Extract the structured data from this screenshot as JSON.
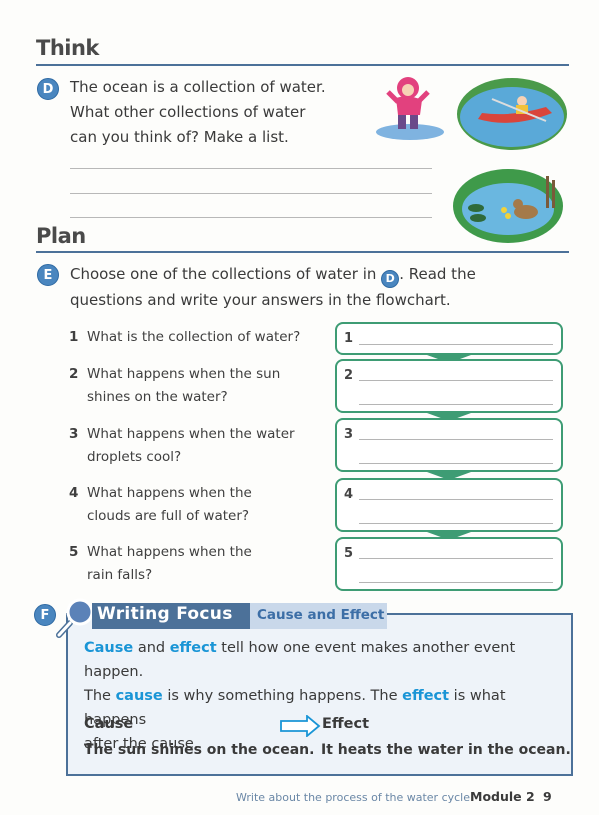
{
  "think": {
    "heading": "Think",
    "badge": "D",
    "question_lines": [
      "The ocean is a collection of water.",
      "What other collections of water",
      "can you think of? Make a list."
    ],
    "answer_lines_count": 3,
    "illustrations": [
      "girl-splashing-puddle-illustration",
      "kayak-river-illustration",
      "duck-pond-illustration"
    ]
  },
  "plan": {
    "heading": "Plan",
    "badge": "E",
    "instruction_part1": "Choose one of the collections of water in",
    "instruction_ref_badge": "D",
    "instruction_part2": ". Read the",
    "instruction_line2": "questions and write your answers in the flowchart.",
    "questions": [
      {
        "num": "1",
        "lines": [
          "What is the collection of water?"
        ]
      },
      {
        "num": "2",
        "lines": [
          "What happens when the sun",
          "shines on the water?"
        ]
      },
      {
        "num": "3",
        "lines": [
          "What happens when the water",
          "droplets cool?"
        ]
      },
      {
        "num": "4",
        "lines": [
          "What happens when the",
          "clouds are full of water?"
        ]
      },
      {
        "num": "5",
        "lines": [
          "What happens when the",
          "rain falls?"
        ]
      }
    ],
    "flowchart_labels": [
      "1",
      "2",
      "3",
      "4",
      "5"
    ],
    "flowchart_color": "#3e9c74"
  },
  "writing_focus": {
    "badge": "F",
    "title": "Writing Focus",
    "subtitle": "Cause and Effect",
    "para": {
      "w1": "Cause",
      "t1": " and ",
      "w2": "effect",
      "t2": " tell how one event makes another event happen.",
      "t3": "The ",
      "w3": "cause",
      "t4": " is why something happens. The ",
      "w4": "effect",
      "t5": " is what happens",
      "t6": "after the cause."
    },
    "cause_label": "Cause",
    "effect_label": "Effect",
    "cause_example": "The sun shines on the ocean.",
    "effect_example": "It heats the water in the ocean.",
    "highlight_color": "#1a95d6"
  },
  "footer": {
    "description": "Write about the process of the water cycle",
    "module": "Module 2",
    "page_number": "9"
  }
}
